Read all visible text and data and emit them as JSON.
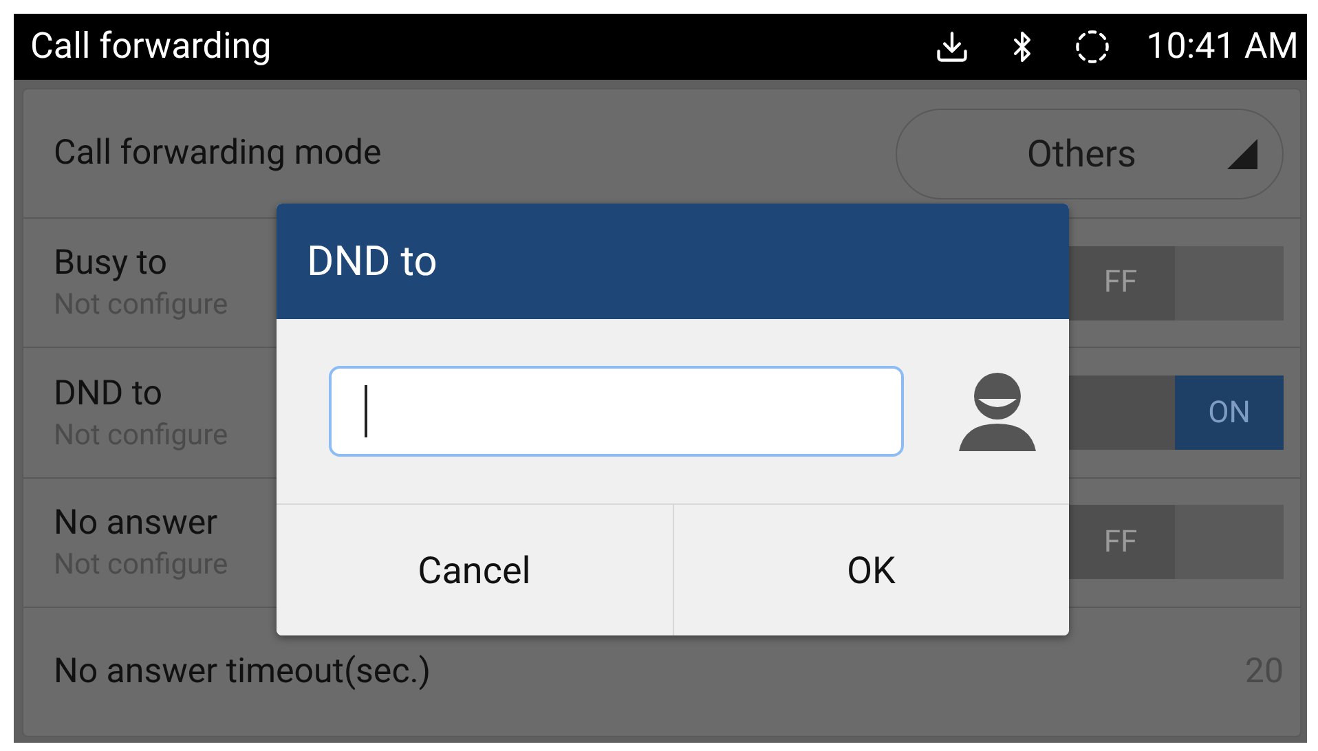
{
  "status_bar": {
    "title": "Call forwarding",
    "time": "10:41 AM"
  },
  "settings": [
    {
      "kind": "dropdown",
      "label": "Call forwarding mode",
      "value": "Others"
    },
    {
      "kind": "toggle",
      "label": "Busy to",
      "subtitle": "Not configure",
      "on": false,
      "toggle_label": "FF"
    },
    {
      "kind": "toggle",
      "label": "DND to",
      "subtitle": "Not configure",
      "on": true,
      "toggle_label": "ON"
    },
    {
      "kind": "toggle",
      "label": "No answer",
      "subtitle": "Not configure",
      "on": false,
      "toggle_label": "FF"
    },
    {
      "kind": "value",
      "label": "No answer timeout(sec.)",
      "value": "20"
    }
  ],
  "dialog": {
    "title": "DND to",
    "buttons": [
      "Cancel",
      "OK"
    ]
  }
}
